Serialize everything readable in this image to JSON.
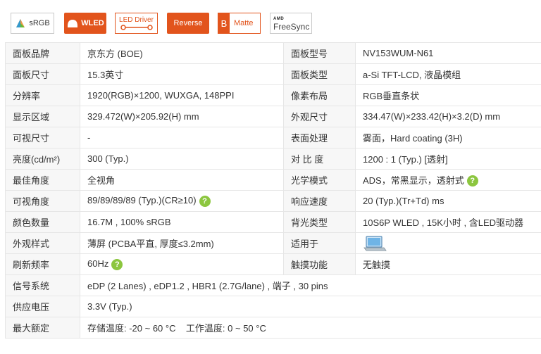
{
  "badges": {
    "srgb": "sRGB",
    "wled": "WLED",
    "led_driver": "LED Driver",
    "reverse": "Reverse",
    "matte_letter": "B",
    "matte": "Matte",
    "amd": "AMD",
    "freesync": "FreeSync"
  },
  "colors": {
    "accent": "#e2541c",
    "help": "#8cc63f",
    "label_bg": "#f7f7f7",
    "border": "#e6e6e6"
  },
  "specs": {
    "brand_label": "面板品牌",
    "brand": "京东方 (BOE)",
    "model_label": "面板型号",
    "model": "NV153WUM-N61",
    "size_label": "面板尺寸",
    "size": "15.3英寸",
    "type_label": "面板类型",
    "type": "a-Si TFT-LCD, 液晶模组",
    "resolution_label": "分辨率",
    "resolution": "1920(RGB)×1200, WUXGA, 148PPI",
    "pixel_label": "像素布局",
    "pixel": "RGB垂直条状",
    "display_area_label": "显示区域",
    "display_area": "329.472(W)×205.92(H) mm",
    "outline_label": "外观尺寸",
    "outline": "334.47(W)×233.42(H)×3.2(D) mm",
    "viewable_label": "可视尺寸",
    "viewable": "-",
    "surface_label": "表面处理",
    "surface": "雾面，Hard coating (3H)",
    "brightness_label": "亮度(cd/m²)",
    "brightness": "300 (Typ.)",
    "contrast_label": "对 比 度",
    "contrast": "1200 : 1 (Typ.) [透射]",
    "best_angle_label": "最佳角度",
    "best_angle": "全视角",
    "optical_label": "光学模式",
    "optical": "ADS，常黑显示，透射式",
    "view_angle_label": "可视角度",
    "view_angle": "89/89/89/89 (Typ.)(CR≥10)",
    "response_label": "响应速度",
    "response": "20 (Typ.)(Tr+Td) ms",
    "colors_label": "颜色数量",
    "colors_val": "16.7M , 100% sRGB",
    "backlight_label": "背光类型",
    "backlight": "10S6P WLED , 15K小时 , 含LED驱动器",
    "style_label": "外观样式",
    "style": "薄屏 (PCBA平直, 厚度≤3.2mm)",
    "apply_label": "适用于",
    "apply_icon": "laptop-icon",
    "refresh_label": "刷新频率",
    "refresh": "60Hz",
    "touch_label": "触摸功能",
    "touch": "无触摸",
    "signal_label": "信号系统",
    "signal": "eDP (2 Lanes) , eDP1.2 , HBR1 (2.7G/lane) , 端子 , 30 pins",
    "voltage_label": "供应电压",
    "voltage": "3.3V (Typ.)",
    "rating_label": "最大额定",
    "rating": "存储温度: -20 ~ 60 °C    工作温度: 0 ~ 50 °C"
  },
  "help_glyph": "?"
}
